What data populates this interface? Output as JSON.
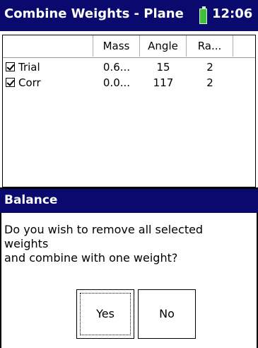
{
  "titlebar": {
    "title": "Combine Weights - Plane",
    "time": "12:06"
  },
  "list": {
    "columns": [
      "",
      "Mass",
      "Angle",
      "Ra..."
    ],
    "rows": [
      {
        "checked": true,
        "name": "Trial",
        "mass": "0.6...",
        "angle": "15",
        "ra": "2"
      },
      {
        "checked": true,
        "name": "Corr",
        "mass": "0.0...",
        "angle": "117",
        "ra": "2"
      }
    ]
  },
  "dialog": {
    "title": "Balance",
    "line1": "Do you wish to remove all selected",
    "line2": "weights",
    "line3": "and combine with one weight?",
    "yes_label": "Yes",
    "no_label": "No"
  },
  "colors": {
    "titlebar_bg": "#0a0a6e",
    "battery": "#3ec23e"
  },
  "icons": {
    "battery": "battery-icon",
    "checkbox": "checkbox-checked-icon"
  }
}
